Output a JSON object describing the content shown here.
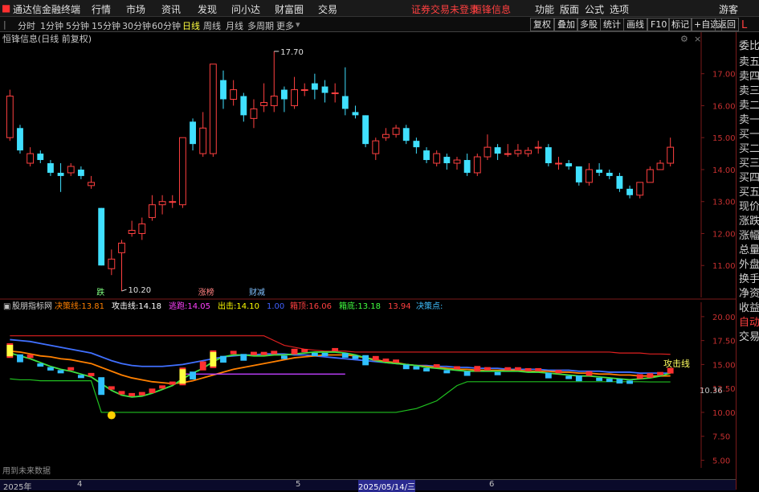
{
  "app": {
    "title": "通达信金融终端",
    "menu": [
      "行情",
      "市场",
      "资讯",
      "发现",
      "问小达",
      "财富圈",
      "交易"
    ],
    "notice": "证券交易未登录",
    "notice2": "恒锋信息",
    "right_menu": [
      "功能",
      "版面",
      "公式",
      "选项"
    ],
    "guest": "游客"
  },
  "toolbar": {
    "timeframes": [
      "分时",
      "1分钟",
      "5分钟",
      "15分钟",
      "30分钟",
      "60分钟",
      "日线",
      "周线",
      "月线",
      "多周期",
      "更多"
    ],
    "active": "日线",
    "buttons": [
      "复权",
      "叠加",
      "多股",
      "统计",
      "画线",
      "F10",
      "标记",
      "+自选",
      "返回"
    ]
  },
  "sidepanel": {
    "items": [
      "委比",
      "卖五",
      "卖四",
      "卖三",
      "卖二",
      "卖一",
      "买一",
      "买二",
      "买三",
      "买四",
      "买五",
      "现价",
      "涨跌",
      "涨幅",
      "总量",
      "外盘",
      "换手",
      "净资",
      "收益"
    ],
    "lower_items": [
      "自动",
      "交易"
    ],
    "marker": "L"
  },
  "chart_data": [
    {
      "type": "candlestick",
      "title": "恒锋信息(日线 前复权)",
      "y_ticks": [
        17.0,
        16.0,
        15.0,
        14.0,
        13.0,
        12.0,
        11.0
      ],
      "ylim": [
        10.0,
        18.3
      ],
      "annotations": [
        {
          "text": "17.70",
          "index": 26,
          "price": 17.7
        },
        {
          "text": "10.20",
          "index": 11,
          "price": 10.2
        }
      ],
      "signals": [
        {
          "text": "跌",
          "index": 9,
          "color": "#80ff80"
        },
        {
          "text": "涨榜",
          "index": 19,
          "color": "#ff8080"
        },
        {
          "text": "财减",
          "index": 24,
          "color": "#80c0ff"
        }
      ],
      "candles": [
        {
          "o": 15.0,
          "c": 16.3,
          "h": 16.5,
          "l": 14.9
        },
        {
          "o": 15.3,
          "c": 14.6,
          "h": 15.4,
          "l": 14.5
        },
        {
          "o": 14.2,
          "c": 14.5,
          "h": 14.7,
          "l": 14.1
        },
        {
          "o": 14.5,
          "c": 14.3,
          "h": 14.6,
          "l": 14.2
        },
        {
          "o": 14.2,
          "c": 13.9,
          "h": 14.3,
          "l": 13.8
        },
        {
          "o": 13.9,
          "c": 13.8,
          "h": 14.2,
          "l": 13.3
        },
        {
          "o": 13.9,
          "c": 14.1,
          "h": 14.2,
          "l": 13.8
        },
        {
          "o": 14.0,
          "c": 13.8,
          "h": 14.1,
          "l": 13.7
        },
        {
          "o": 13.5,
          "c": 13.6,
          "h": 13.8,
          "l": 13.4
        },
        {
          "o": 12.8,
          "c": 11.0,
          "h": 12.8,
          "l": 11.0
        },
        {
          "o": 10.9,
          "c": 11.2,
          "h": 11.5,
          "l": 10.7
        },
        {
          "o": 11.4,
          "c": 11.7,
          "h": 11.8,
          "l": 10.2
        },
        {
          "o": 12.0,
          "c": 12.1,
          "h": 12.4,
          "l": 11.9
        },
        {
          "o": 12.0,
          "c": 12.3,
          "h": 12.5,
          "l": 11.8
        },
        {
          "o": 12.5,
          "c": 12.9,
          "h": 13.2,
          "l": 12.4
        },
        {
          "o": 12.9,
          "c": 13.0,
          "h": 13.2,
          "l": 12.6
        },
        {
          "o": 13.0,
          "c": 13.0,
          "h": 13.2,
          "l": 12.8
        },
        {
          "o": 12.9,
          "c": 15.0,
          "h": 15.0,
          "l": 12.8
        },
        {
          "o": 15.5,
          "c": 14.8,
          "h": 15.6,
          "l": 14.6
        },
        {
          "o": 14.5,
          "c": 15.3,
          "h": 15.8,
          "l": 14.4
        },
        {
          "o": 14.5,
          "c": 17.3,
          "h": 17.3,
          "l": 14.4
        },
        {
          "o": 16.8,
          "c": 16.2,
          "h": 17.1,
          "l": 15.9
        },
        {
          "o": 16.2,
          "c": 16.5,
          "h": 16.8,
          "l": 16.0
        },
        {
          "o": 16.3,
          "c": 15.7,
          "h": 16.4,
          "l": 15.5
        },
        {
          "o": 15.6,
          "c": 15.9,
          "h": 16.2,
          "l": 15.3
        },
        {
          "o": 16.0,
          "c": 16.1,
          "h": 16.7,
          "l": 15.8
        },
        {
          "o": 16.0,
          "c": 16.3,
          "h": 17.7,
          "l": 15.8
        },
        {
          "o": 16.5,
          "c": 16.2,
          "h": 16.6,
          "l": 15.8
        },
        {
          "o": 16.0,
          "c": 16.5,
          "h": 16.9,
          "l": 15.9
        },
        {
          "o": 16.5,
          "c": 16.5,
          "h": 16.7,
          "l": 16.3
        },
        {
          "o": 16.7,
          "c": 16.5,
          "h": 17.0,
          "l": 16.2
        },
        {
          "o": 16.6,
          "c": 16.4,
          "h": 16.8,
          "l": 16.1
        },
        {
          "o": 16.4,
          "c": 16.4,
          "h": 16.7,
          "l": 16.1
        },
        {
          "o": 16.3,
          "c": 15.9,
          "h": 17.2,
          "l": 15.7
        },
        {
          "o": 15.8,
          "c": 15.7,
          "h": 16.0,
          "l": 15.6
        },
        {
          "o": 15.7,
          "c": 14.8,
          "h": 15.7,
          "l": 14.7
        },
        {
          "o": 14.5,
          "c": 14.9,
          "h": 15.0,
          "l": 14.3
        },
        {
          "o": 15.0,
          "c": 15.1,
          "h": 15.3,
          "l": 14.9
        },
        {
          "o": 15.1,
          "c": 15.3,
          "h": 15.4,
          "l": 15.0
        },
        {
          "o": 15.3,
          "c": 14.9,
          "h": 15.4,
          "l": 14.8
        },
        {
          "o": 14.9,
          "c": 14.7,
          "h": 15.0,
          "l": 14.5
        },
        {
          "o": 14.6,
          "c": 14.3,
          "h": 14.7,
          "l": 14.2
        },
        {
          "o": 14.2,
          "c": 14.5,
          "h": 14.6,
          "l": 14.1
        },
        {
          "o": 14.4,
          "c": 14.2,
          "h": 14.5,
          "l": 14.0
        },
        {
          "o": 14.2,
          "c": 14.3,
          "h": 14.4,
          "l": 14.0
        },
        {
          "o": 14.3,
          "c": 13.9,
          "h": 14.5,
          "l": 13.8
        },
        {
          "o": 13.9,
          "c": 14.4,
          "h": 14.5,
          "l": 13.8
        },
        {
          "o": 14.4,
          "c": 14.7,
          "h": 15.1,
          "l": 14.3
        },
        {
          "o": 14.7,
          "c": 14.5,
          "h": 14.8,
          "l": 14.3
        },
        {
          "o": 14.5,
          "c": 14.5,
          "h": 14.8,
          "l": 14.4
        },
        {
          "o": 14.5,
          "c": 14.6,
          "h": 14.8,
          "l": 14.4
        },
        {
          "o": 14.5,
          "c": 14.6,
          "h": 14.7,
          "l": 14.4
        },
        {
          "o": 14.7,
          "c": 14.7,
          "h": 14.9,
          "l": 14.5
        },
        {
          "o": 14.7,
          "c": 14.2,
          "h": 14.8,
          "l": 14.1
        },
        {
          "o": 14.2,
          "c": 14.2,
          "h": 14.4,
          "l": 14.0
        },
        {
          "o": 14.2,
          "c": 14.1,
          "h": 14.3,
          "l": 14.0
        },
        {
          "o": 14.1,
          "c": 13.6,
          "h": 14.1,
          "l": 13.5
        },
        {
          "o": 13.6,
          "c": 14.0,
          "h": 14.2,
          "l": 13.5
        },
        {
          "o": 14.0,
          "c": 13.9,
          "h": 14.2,
          "l": 13.8
        },
        {
          "o": 13.9,
          "c": 13.8,
          "h": 14.0,
          "l": 13.7
        },
        {
          "o": 13.8,
          "c": 13.4,
          "h": 13.9,
          "l": 13.3
        },
        {
          "o": 13.4,
          "c": 13.2,
          "h": 13.5,
          "l": 13.1
        },
        {
          "o": 13.2,
          "c": 13.6,
          "h": 13.6,
          "l": 13.1
        },
        {
          "o": 13.6,
          "c": 14.0,
          "h": 14.1,
          "l": 13.6
        },
        {
          "o": 14.0,
          "c": 14.2,
          "h": 14.3,
          "l": 14.0
        },
        {
          "o": 14.2,
          "c": 14.7,
          "h": 15.0,
          "l": 14.1
        }
      ]
    },
    {
      "type": "indicator",
      "title": "股朋指标网",
      "y_ticks": [
        20.0,
        17.5,
        15.0,
        12.5,
        10.0,
        7.5,
        5.0
      ],
      "ylim": [
        4.2,
        21.5
      ],
      "legend": [
        {
          "label": "决策线:",
          "value": "13.81",
          "color": "#ff8000"
        },
        {
          "label": "攻击线:",
          "value": "14.18",
          "color": "#ffffff"
        },
        {
          "label": "逃跑:",
          "value": "14.05",
          "color": "#ff40ff"
        },
        {
          "label": "出击:",
          "value": "14.10",
          "color": "#ffff00"
        },
        {
          "label": "",
          "value": "1.00",
          "color": "#4060ff"
        },
        {
          "label": "箱顶:",
          "value": "16.06",
          "color": "#ff4040"
        },
        {
          "label": "箱底:",
          "value": "13.18",
          "color": "#40ff40"
        },
        {
          "label": "",
          "value": "13.94",
          "color": "#ff4040"
        },
        {
          "label": "决策点:",
          "value": "",
          "color": "#40c0ff"
        }
      ],
      "current_value": "10.36",
      "end_label": "攻击线",
      "box_top": [
        18.0,
        18.0,
        18.0,
        18.0,
        18.0,
        18.0,
        18.0,
        18.0,
        18.0,
        18.0,
        18.0,
        18.0,
        18.0,
        18.0,
        18.0,
        18.0,
        18.0,
        18.0,
        18.0,
        18.0,
        18.0,
        18.0,
        18.0,
        18.0,
        18.0,
        18.0,
        17.5,
        17.0,
        16.8,
        16.6,
        16.5,
        16.4,
        16.4,
        16.4,
        16.3,
        16.3,
        16.3,
        16.3,
        16.3,
        16.3,
        16.3,
        16.3,
        16.3,
        16.3,
        16.3,
        16.3,
        16.3,
        16.3,
        16.3,
        16.3,
        16.3,
        16.3,
        16.3,
        16.3,
        16.3,
        16.3,
        16.3,
        16.3,
        16.3,
        16.3,
        16.2,
        16.2,
        16.2,
        16.1,
        16.1,
        16.06
      ],
      "box_bottom": [
        13.5,
        13.4,
        13.4,
        13.3,
        13.3,
        13.3,
        13.3,
        13.3,
        13.3,
        10.0,
        10.0,
        10.0,
        10.0,
        10.0,
        10.0,
        10.0,
        10.0,
        10.0,
        10.0,
        10.0,
        10.0,
        10.0,
        10.0,
        10.0,
        10.0,
        10.0,
        10.0,
        10.0,
        10.0,
        10.0,
        10.0,
        10.0,
        10.0,
        10.0,
        10.0,
        10.0,
        10.0,
        10.0,
        10.0,
        10.2,
        10.4,
        10.8,
        11.2,
        12.0,
        12.8,
        13.2,
        13.2,
        13.2,
        13.2,
        13.2,
        13.2,
        13.2,
        13.2,
        13.2,
        13.2,
        13.2,
        13.2,
        13.2,
        13.2,
        13.2,
        13.2,
        13.2,
        13.2,
        13.18,
        13.18,
        13.18
      ],
      "decision_line": [
        16.4,
        16.3,
        16.1,
        15.9,
        15.8,
        15.6,
        15.5,
        15.3,
        15.1,
        14.7,
        14.3,
        13.9,
        13.6,
        13.4,
        13.2,
        13.1,
        13.0,
        13.1,
        13.3,
        13.6,
        13.9,
        14.2,
        14.5,
        14.7,
        14.9,
        15.1,
        15.3,
        15.5,
        15.7,
        15.8,
        15.9,
        16.0,
        16.0,
        16.0,
        15.9,
        15.7,
        15.5,
        15.3,
        15.2,
        15.0,
        14.9,
        14.8,
        14.7,
        14.6,
        14.5,
        14.5,
        14.4,
        14.4,
        14.4,
        14.4,
        14.4,
        14.3,
        14.3,
        14.3,
        14.2,
        14.2,
        14.1,
        14.1,
        14.0,
        14.0,
        13.9,
        13.9,
        13.8,
        13.8,
        13.8,
        13.81
      ],
      "blue_line": [
        17.6,
        17.5,
        17.4,
        17.2,
        17.0,
        16.8,
        16.6,
        16.4,
        16.2,
        15.8,
        15.4,
        15.1,
        14.9,
        14.8,
        14.8,
        14.8,
        14.9,
        15.0,
        15.2,
        15.4,
        15.6,
        15.8,
        15.9,
        16.0,
        16.0,
        16.1,
        16.1,
        16.1,
        16.0,
        16.0,
        15.9,
        15.8,
        15.7,
        15.6,
        15.5,
        15.4,
        15.3,
        15.2,
        15.1,
        15.0,
        14.9,
        14.9,
        14.8,
        14.8,
        14.7,
        14.7,
        14.6,
        14.6,
        14.6,
        14.5,
        14.5,
        14.5,
        14.5,
        14.4,
        14.4,
        14.4,
        14.3,
        14.3,
        14.3,
        14.2,
        14.2,
        14.2,
        14.1,
        14.1,
        14.1,
        14.1
      ],
      "green_line": [
        16.2,
        15.9,
        15.6,
        15.2,
        14.8,
        14.5,
        14.3,
        14.0,
        13.7,
        13.0,
        12.3,
        11.8,
        11.6,
        11.7,
        12.0,
        12.4,
        12.8,
        13.5,
        14.1,
        14.6,
        15.3,
        15.8,
        16.0,
        16.0,
        15.9,
        15.9,
        16.0,
        16.0,
        16.1,
        16.2,
        16.3,
        16.3,
        16.3,
        16.2,
        16.0,
        15.7,
        15.4,
        15.2,
        15.1,
        15.0,
        14.9,
        14.7,
        14.6,
        14.5,
        14.4,
        14.3,
        14.3,
        14.3,
        14.3,
        14.3,
        14.3,
        14.2,
        14.2,
        14.1,
        14.0,
        13.9,
        13.8,
        13.8,
        13.7,
        13.6,
        13.5,
        13.4,
        13.5,
        13.6,
        13.8,
        14.1
      ]
    }
  ],
  "bottom": {
    "left_note": "用到未来数据",
    "dates": [
      "2025年",
      "4",
      "5",
      "2025/05/14/三",
      "6"
    ]
  }
}
